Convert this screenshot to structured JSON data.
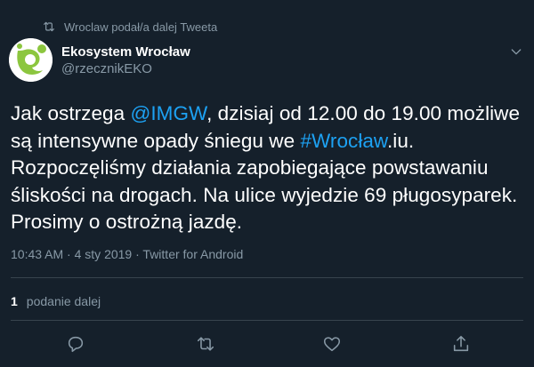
{
  "retweet": {
    "text": "Wroclaw podał/a dalej Tweeta"
  },
  "author": {
    "display_name": "Ekosystem Wrocław",
    "handle": "@rzecznikEKO"
  },
  "tweet": {
    "part1": "Jak ostrzega ",
    "mention": "@IMGW",
    "part2": ", dzisiaj od 12.00 do 19.00 możliwe są intensywne opady śniegu we ",
    "hashtag": "#Wrocław",
    "part3": ".iu. Rozpoczęliśmy działania zapobiegające powstawaniu śliskości na drogach. Na ulice wyjedzie 69 pługosyparek. Prosimy o ostrożną jazdę."
  },
  "meta": {
    "time": "10:43 AM",
    "sep1": " · ",
    "date": "4 sty 2019",
    "sep2": " · ",
    "source": "Twitter for Android"
  },
  "stats": {
    "retweet_count": "1",
    "retweet_label": "podanie dalej"
  },
  "colors": {
    "background": "#15202b",
    "link": "#1da1f2",
    "muted": "#8899a6",
    "divider": "#38444d",
    "avatar_green": "#8cc63f"
  }
}
